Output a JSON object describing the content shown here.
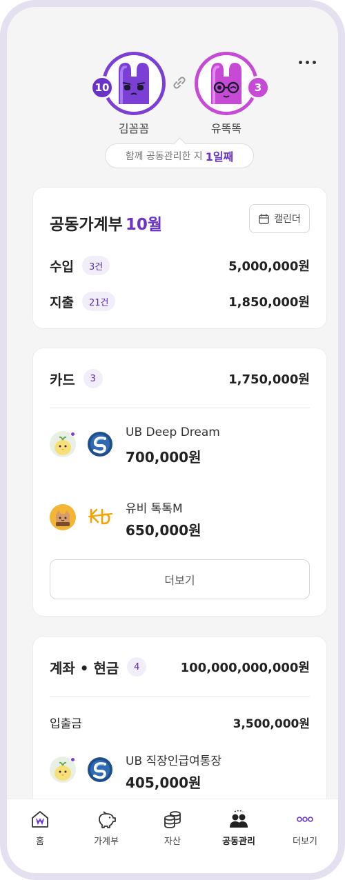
{
  "header": {
    "members": [
      {
        "name": "김꼼꼼",
        "count": "10"
      },
      {
        "name": "유똑똑",
        "count": "3"
      }
    ],
    "together_prefix": "함께 공동관리한 지",
    "together_days": "1일째"
  },
  "ledger": {
    "title": "공동가계부",
    "month": "10월",
    "calendar_label": "캘린더",
    "income": {
      "label": "수입",
      "count": "3건",
      "amount": "5,000,000원"
    },
    "expense": {
      "label": "지출",
      "count": "21건",
      "amount": "1,850,000원"
    }
  },
  "cards": {
    "title": "카드",
    "count": "3",
    "total": "1,750,000원",
    "items": [
      {
        "name": "UB Deep Dream",
        "amount": "700,000원",
        "brand_icon": "shinhan-logo",
        "owner_icon": "chick-avatar"
      },
      {
        "name": "유비 톡톡M",
        "amount": "650,000원",
        "brand_icon": "kb-logo",
        "owner_icon": "cat-avatar"
      }
    ],
    "more_label": "더보기"
  },
  "accounts": {
    "title": "계좌 • 현금",
    "count": "4",
    "total": "100,000,000,000원",
    "sub_label": "입출금",
    "sub_amount": "3,500,000원",
    "items": [
      {
        "name": "UB 직장인급여통장",
        "amount": "405,000원",
        "brand_icon": "shinhan-logo",
        "owner_icon": "chick-avatar"
      }
    ]
  },
  "nav": [
    {
      "label": "홈",
      "icon": "home-won-icon"
    },
    {
      "label": "가계부",
      "icon": "piggy-bank-icon"
    },
    {
      "label": "자산",
      "icon": "coins-icon"
    },
    {
      "label": "공동관리",
      "icon": "people-icon",
      "active": true
    },
    {
      "label": "더보기",
      "icon": "more-icon"
    }
  ],
  "colors": {
    "accent": "#6a33c8",
    "accent_pink": "#c64ad6",
    "chip_bg": "#f1eefa"
  }
}
